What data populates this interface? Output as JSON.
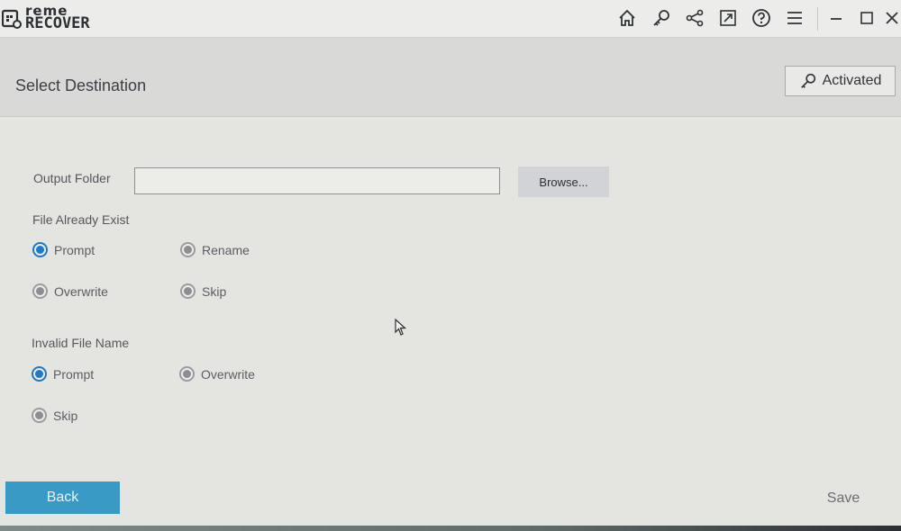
{
  "app": {
    "logo_line1": "reme",
    "logo_line2": "RECOVER"
  },
  "titlebar": {
    "icons": [
      "home-icon",
      "key-icon",
      "share-icon",
      "export-icon",
      "help-icon",
      "menu-icon",
      "minimize-icon",
      "maximize-icon",
      "close-icon"
    ]
  },
  "header": {
    "title": "Select Destination",
    "activated_label": "Activated"
  },
  "output": {
    "label": "Output Folder",
    "value": "",
    "browse_label": "Browse..."
  },
  "file_already_exist": {
    "label": "File Already Exist",
    "options": [
      {
        "label": "Prompt",
        "checked": true
      },
      {
        "label": "Rename",
        "checked": false
      },
      {
        "label": "Overwrite",
        "checked": false
      },
      {
        "label": "Skip",
        "checked": false
      }
    ]
  },
  "invalid_file_name": {
    "label": "Invalid File Name",
    "options": [
      {
        "label": "Prompt",
        "checked": true
      },
      {
        "label": "Overwrite",
        "checked": false
      },
      {
        "label": "Skip",
        "checked": false
      }
    ]
  },
  "footer": {
    "back_label": "Back",
    "save_label": "Save"
  },
  "colors": {
    "accent": "#3a9ac6",
    "radio_checked": "#1f78c8"
  }
}
